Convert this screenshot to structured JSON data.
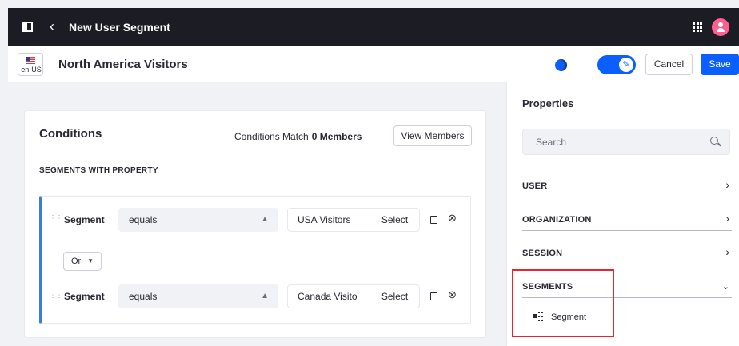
{
  "topbar": {
    "title": "New User Segment"
  },
  "segment": {
    "language": "en-US",
    "name": "North America Visitors",
    "cancel_label": "Cancel",
    "save_label": "Save"
  },
  "conditions": {
    "title": "Conditions",
    "match_label": "Conditions Match",
    "match_count": "0 Members",
    "view_members_label": "View Members",
    "section_heading": "SEGMENTS WITH PROPERTY",
    "conjunction": "Or",
    "rows": [
      {
        "property": "Segment",
        "operator": "equals",
        "value": "USA Visitors",
        "select_label": "Select"
      },
      {
        "property": "Segment",
        "operator": "equals",
        "value": "Canada Visito",
        "select_label": "Select"
      }
    ]
  },
  "properties": {
    "title": "Properties",
    "search_placeholder": "Search",
    "categories": [
      {
        "label": "USER",
        "expanded": false
      },
      {
        "label": "ORGANIZATION",
        "expanded": false
      },
      {
        "label": "SESSION",
        "expanded": false
      },
      {
        "label": "SEGMENTS",
        "expanded": true
      }
    ],
    "segment_items": [
      {
        "label": "Segment"
      }
    ]
  },
  "colors": {
    "primary": "#0b5fff",
    "topbar": "#1c1c24",
    "highlight": "#e5262b"
  }
}
